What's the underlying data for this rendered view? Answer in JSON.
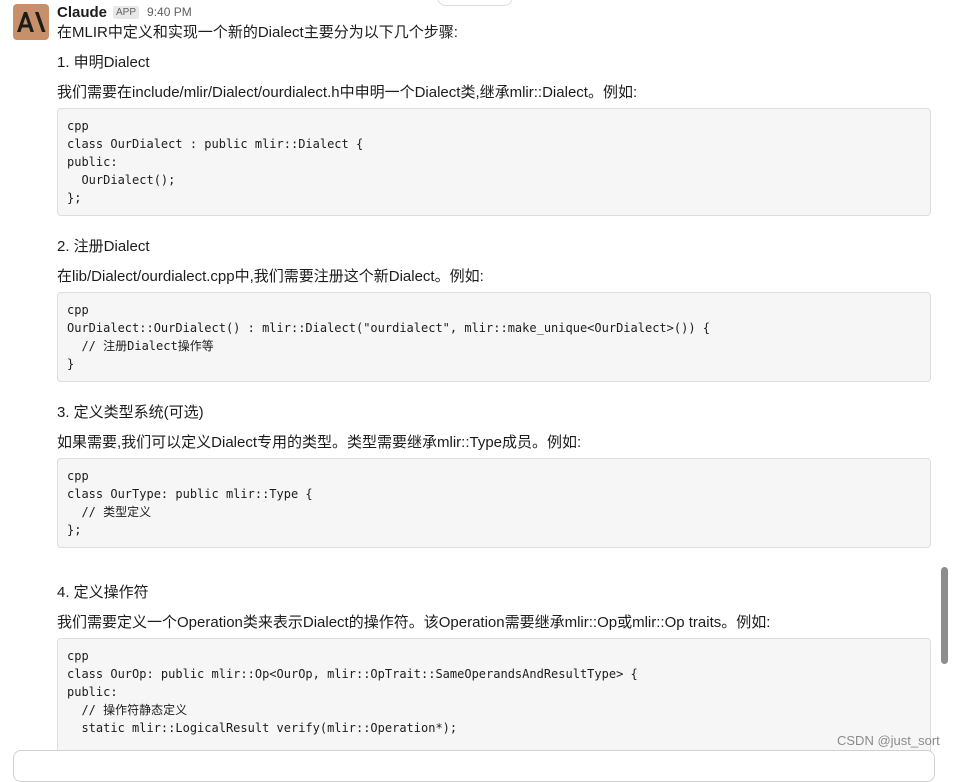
{
  "message": {
    "sender": "Claude",
    "badge": "APP",
    "time": "9:40 PM",
    "intro": "在MLIR中定义和实现一个新的Dialect主要分为以下几个步骤:"
  },
  "steps": [
    {
      "heading": "1. 申明Dialect",
      "desc": "我们需要在include/mlir/Dialect/ourdialect.h中申明一个Dialect类,继承mlir::Dialect。例如:",
      "code": [
        "cpp",
        "class OurDialect : public mlir::Dialect {",
        "public:",
        "  OurDialect();",
        "};"
      ]
    },
    {
      "heading": "2. 注册Dialect",
      "desc": "在lib/Dialect/ourdialect.cpp中,我们需要注册这个新Dialect。例如:",
      "code": [
        "cpp",
        "OurDialect::OurDialect() : mlir::Dialect(\"ourdialect\", mlir::make_unique<OurDialect>()) {",
        "  // 注册Dialect操作等",
        "}"
      ]
    },
    {
      "heading": "3. 定义类型系统(可选)",
      "desc": "如果需要,我们可以定义Dialect专用的类型。类型需要继承mlir::Type成员。例如:",
      "code": [
        "cpp",
        "class OurType: public mlir::Type {",
        "  // 类型定义",
        "};"
      ]
    },
    {
      "heading": "4. 定义操作符",
      "desc": "我们需要定义一个Operation类来表示Dialect的操作符。该Operation需要继承mlir::Op或mlir::Op traits。例如:",
      "code": [
        "cpp",
        "class OurOp: public mlir::Op<OurOp, mlir::OpTrait::SameOperandsAndResultType> {",
        "public:",
        "  // 操作符静态定义",
        "  static mlir::LogicalResult verify(mlir::Operation*);"
      ]
    }
  ],
  "watermark": "CSDN @just_sort",
  "colors": {
    "avatar": "#c8906a",
    "code_bg": "#f6f6f6",
    "text": "#1d1c1d"
  }
}
